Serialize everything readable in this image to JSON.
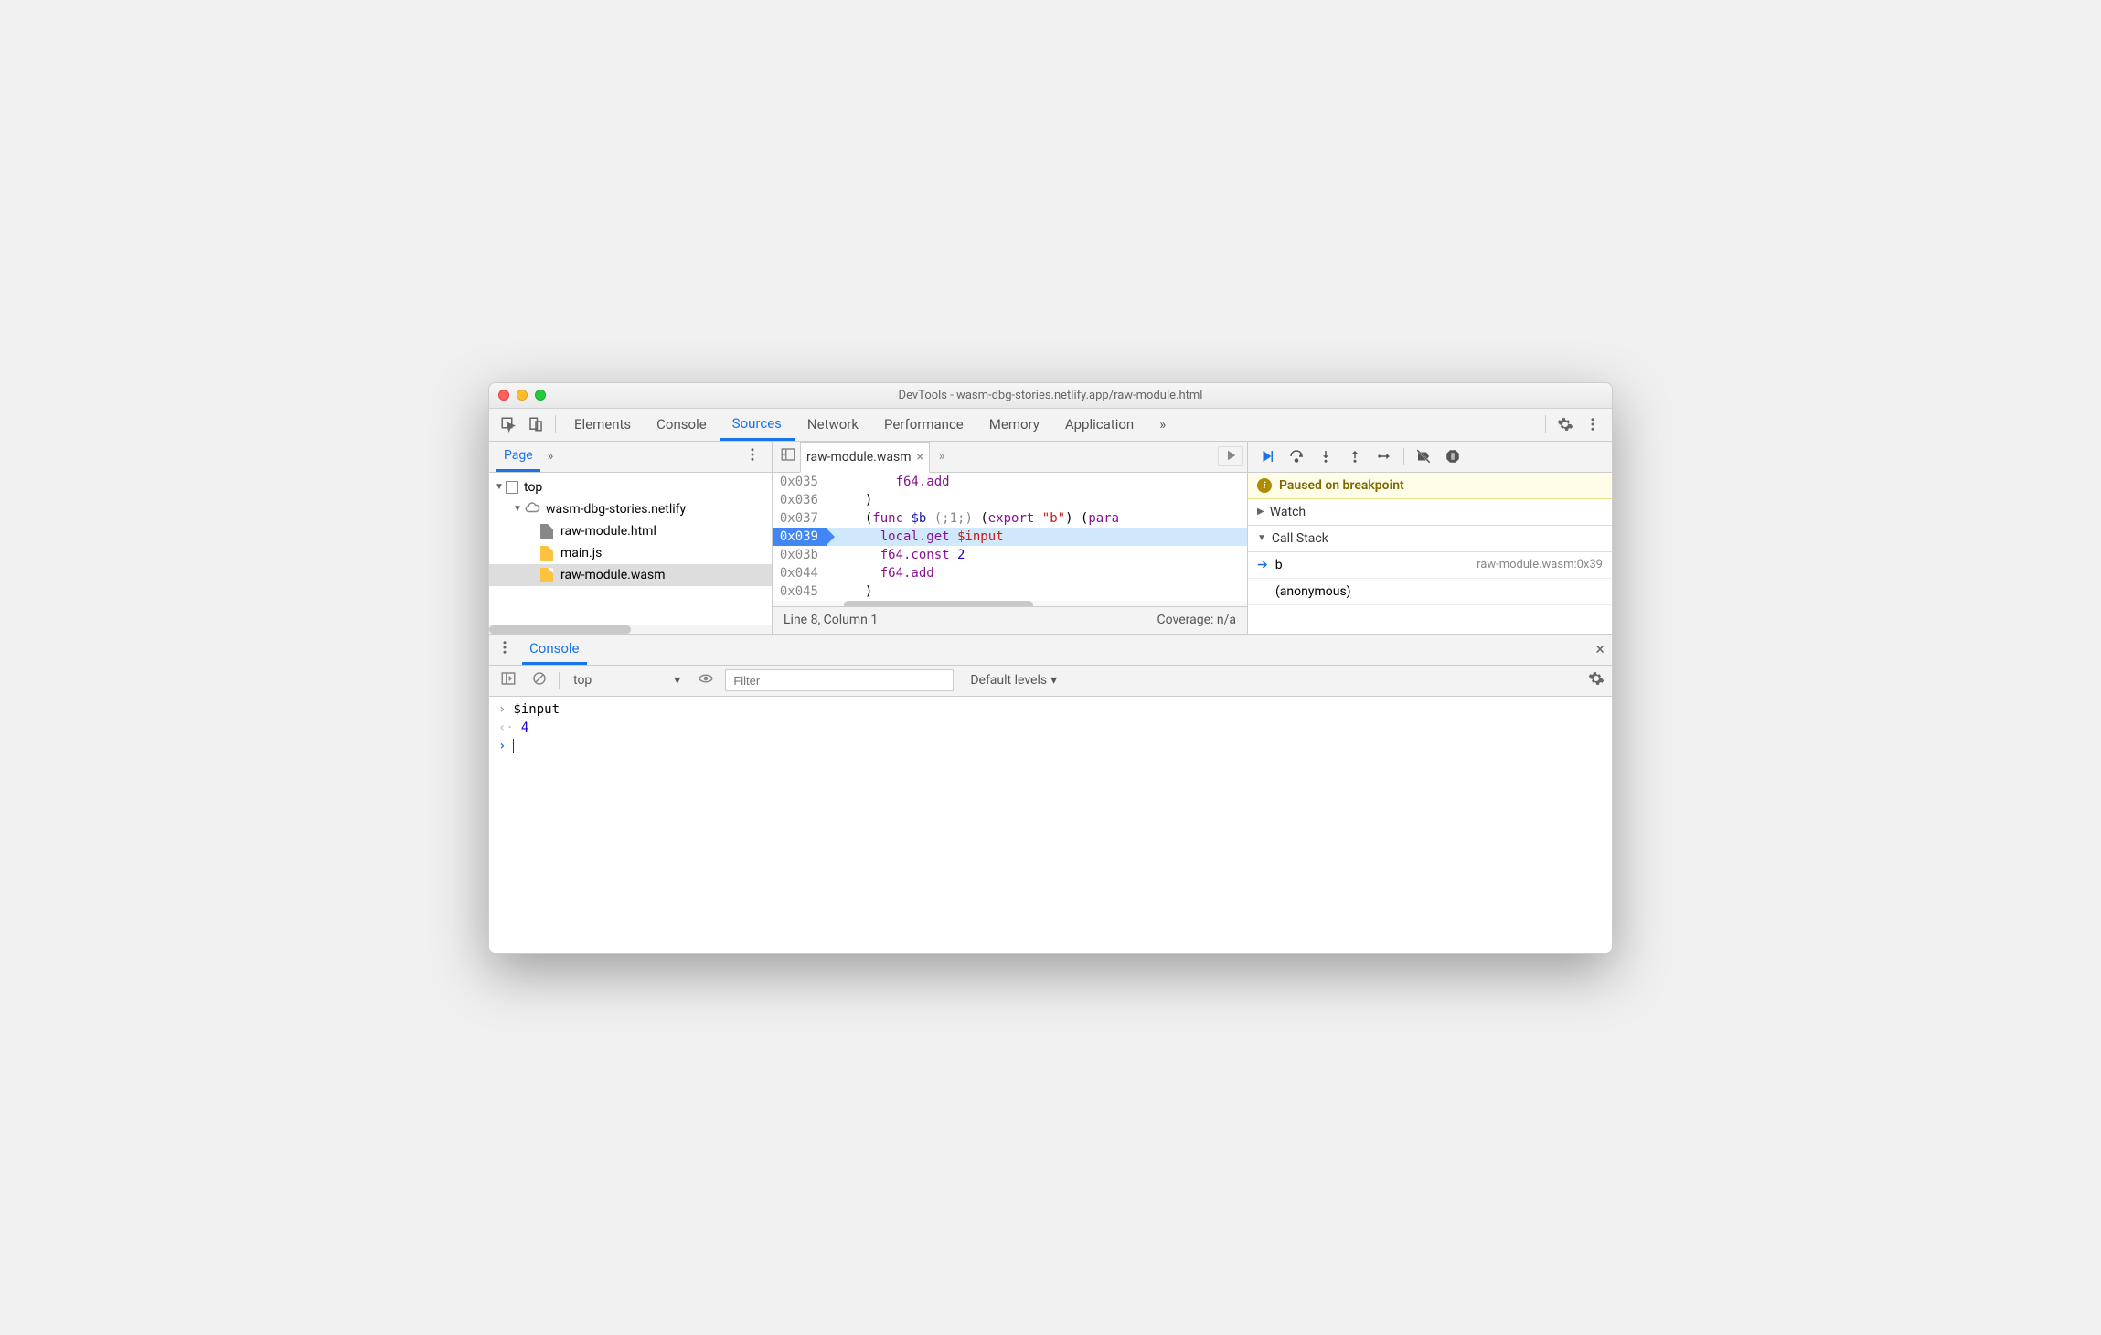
{
  "title": "DevTools - wasm-dbg-stories.netlify.app/raw-module.html",
  "tabs": {
    "elements": "Elements",
    "console": "Console",
    "sources": "Sources",
    "network": "Network",
    "performance": "Performance",
    "memory": "Memory",
    "application": "Application",
    "more": "»"
  },
  "nav": {
    "page_tab": "Page",
    "more": "»",
    "tree": {
      "top": "top",
      "origin": "wasm-dbg-stories.netlify",
      "files": {
        "html": "raw-module.html",
        "js": "main.js",
        "wasm": "raw-module.wasm"
      }
    }
  },
  "editor": {
    "tab": "raw-module.wasm",
    "more": "»",
    "lines": {
      "l0": {
        "addr": "0x035",
        "text": "f64.add"
      },
      "l1": {
        "addr": "0x036",
        "text": ")"
      },
      "l2": {
        "addr": "0x037",
        "pre": "(",
        "kw": "func",
        "fn": " $b",
        "co": " (;1;)",
        "pre2": " (",
        "kw2": "export ",
        "str": "\"b\"",
        "post": ") (",
        "kw3": "para"
      },
      "l3": {
        "addr": "0x039",
        "kw": "local.get",
        "name": " $input"
      },
      "l4": {
        "addr": "0x03b",
        "kw": "f64.const",
        "num": " 2"
      },
      "l5": {
        "addr": "0x044",
        "kw": "f64.add"
      },
      "l6": {
        "addr": "0x045",
        "text": ")"
      }
    },
    "footer": {
      "pos": "Line 8, Column 1",
      "cov": "Coverage: n/a"
    }
  },
  "debugger": {
    "paused": "Paused on breakpoint",
    "watch": "Watch",
    "callstack": "Call Stack",
    "frames": {
      "f0": {
        "name": "b",
        "loc": "raw-module.wasm:0x39"
      },
      "f1": {
        "name": "(anonymous)"
      }
    }
  },
  "drawer": {
    "tab": "Console",
    "toolbar": {
      "context": "top",
      "context_arrow": "▾",
      "filter_placeholder": "Filter",
      "levels": "Default levels",
      "levels_arrow": "▾"
    },
    "console": {
      "input1": "$input",
      "output1": "4"
    }
  }
}
